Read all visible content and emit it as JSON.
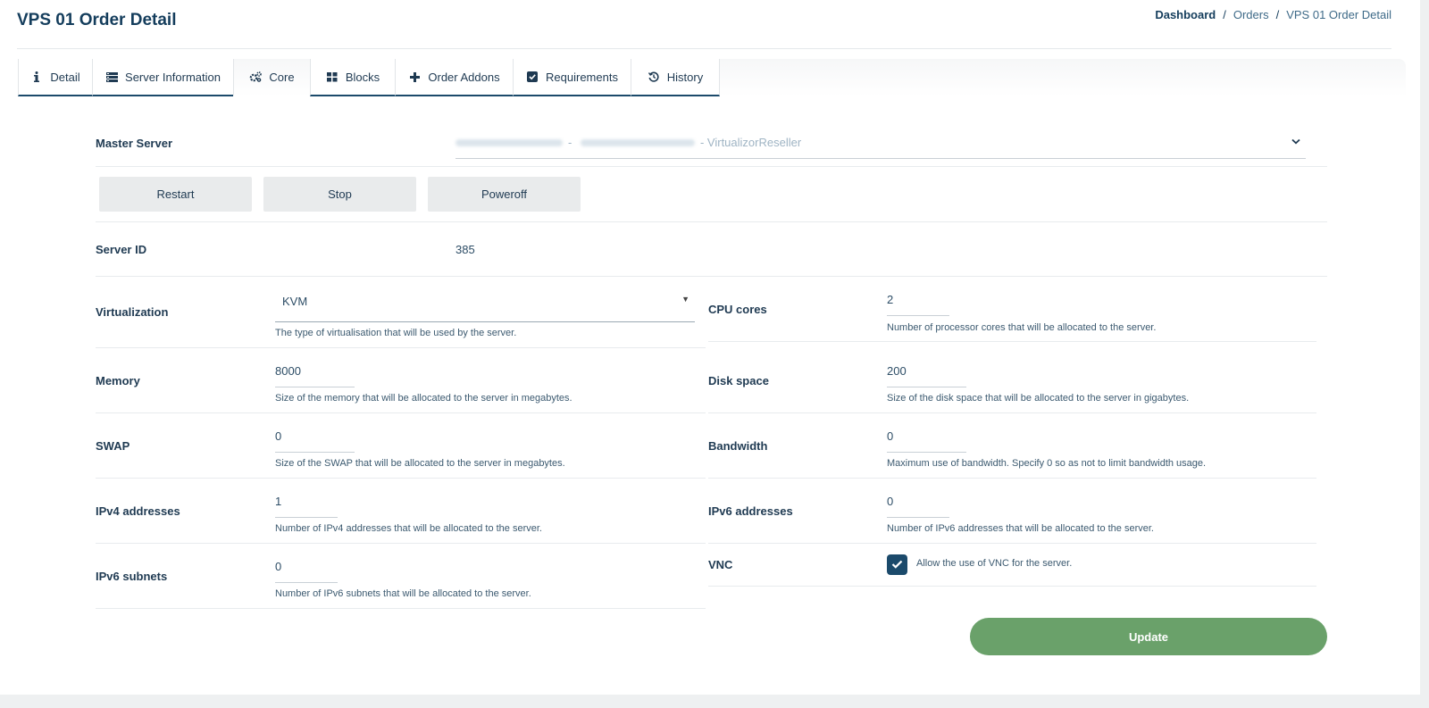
{
  "page": {
    "title": "VPS 01 Order Detail"
  },
  "breadcrumb": {
    "home": "Dashboard",
    "sep": "/",
    "orders": "Orders",
    "current": "VPS 01 Order Detail"
  },
  "tabs": [
    {
      "label": "Detail",
      "icon": "info-icon"
    },
    {
      "label": "Server Information",
      "icon": "server-list-icon"
    },
    {
      "label": "Core",
      "icon": "cogs-icon"
    },
    {
      "label": "Blocks",
      "icon": "blocks-icon"
    },
    {
      "label": "Order Addons",
      "icon": "plus-icon"
    },
    {
      "label": "Requirements",
      "icon": "checkbox-icon"
    },
    {
      "label": "History",
      "icon": "history-icon"
    }
  ],
  "master": {
    "label": "Master Server",
    "value_suffix": "- VirtualizorReseller",
    "sep": "-"
  },
  "actions": {
    "restart": "Restart",
    "stop": "Stop",
    "poweroff": "Poweroff"
  },
  "server_id": {
    "label": "Server ID",
    "value": "385"
  },
  "fields": {
    "virtualization": {
      "label": "Virtualization",
      "value": "KVM",
      "help": "The type of virtualisation that will be used by the server."
    },
    "cpu_cores": {
      "label": "CPU cores",
      "value": "2",
      "help": "Number of processor cores that will be allocated to the server."
    },
    "memory": {
      "label": "Memory",
      "value": "8000",
      "help": "Size of the memory that will be allocated to the server in megabytes."
    },
    "disk_space": {
      "label": "Disk space",
      "value": "200",
      "help": "Size of the disk space that will be allocated to the server in gigabytes."
    },
    "swap": {
      "label": "SWAP",
      "value": "0",
      "help": "Size of the SWAP that will be allocated to the server in megabytes."
    },
    "bandwidth": {
      "label": "Bandwidth",
      "value": "0",
      "help": "Maximum use of bandwidth. Specify 0 so as not to limit bandwidth usage."
    },
    "ipv4": {
      "label": "IPv4 addresses",
      "value": "1",
      "help": "Number of IPv4 addresses that will be allocated to the server."
    },
    "ipv6": {
      "label": "IPv6 addresses",
      "value": "0",
      "help": "Number of IPv6 addresses that will be allocated to the server."
    },
    "ipv6_subnets": {
      "label": "IPv6 subnets",
      "value": "0",
      "help": "Number of IPv6 subnets that will be allocated to the server."
    },
    "vnc": {
      "label": "VNC",
      "checked": true,
      "help": "Allow the use of VNC for the server."
    }
  },
  "update": {
    "label": "Update"
  },
  "colors": {
    "primary": "#1b4a6b",
    "update": "#6aa16a",
    "button_bg": "#e9ebec"
  }
}
